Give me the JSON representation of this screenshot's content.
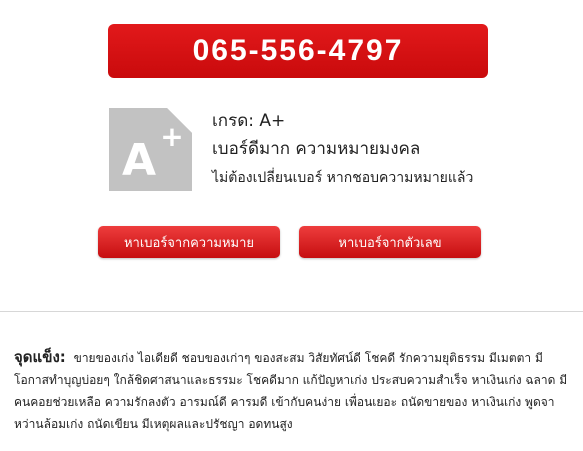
{
  "phone": {
    "number": "065-556-4797"
  },
  "grade": {
    "badge_text": "A+",
    "line": "เกรด: A+",
    "meaning": "เบอร์ดีมาก ความหมายมงคล",
    "note": "ไม่ต้องเปลี่ยนเบอร์ หากชอบความหมายแล้ว"
  },
  "buttons": {
    "search_by_meaning": "หาเบอร์จากความหมาย",
    "search_by_digits": "หาเบอร์จากตัวเลข"
  },
  "strengths": {
    "label": "จุดแข็ง:",
    "text": "ขายของเก่ง ไอเดียดี ชอบของเก่าๆ ของสะสม วิสัยทัศน์ดี โชคดี รักความยุติธรรม มีเมตตา มีโอกาสทำบุญบ่อยๆ ใกล้ชิดศาสนาและธรรมะ โชคดีมาก แก้ปัญหาเก่ง ประสบความสำเร็จ หาเงินเก่ง ฉลาด มีคนคอยช่วยเหลือ ความรักลงตัว อารมณ์ดี คารมดี เข้ากับคนง่าย เพื่อนเยอะ ถนัดขายของ หาเงินเก่ง พูดจาหว่านล้อมเก่ง ถนัดเขียน มีเหตุผลและปรัชญา อดทนสูง"
  },
  "colors": {
    "brand_red": "#d31214",
    "badge_gray": "#c2c2c2"
  }
}
